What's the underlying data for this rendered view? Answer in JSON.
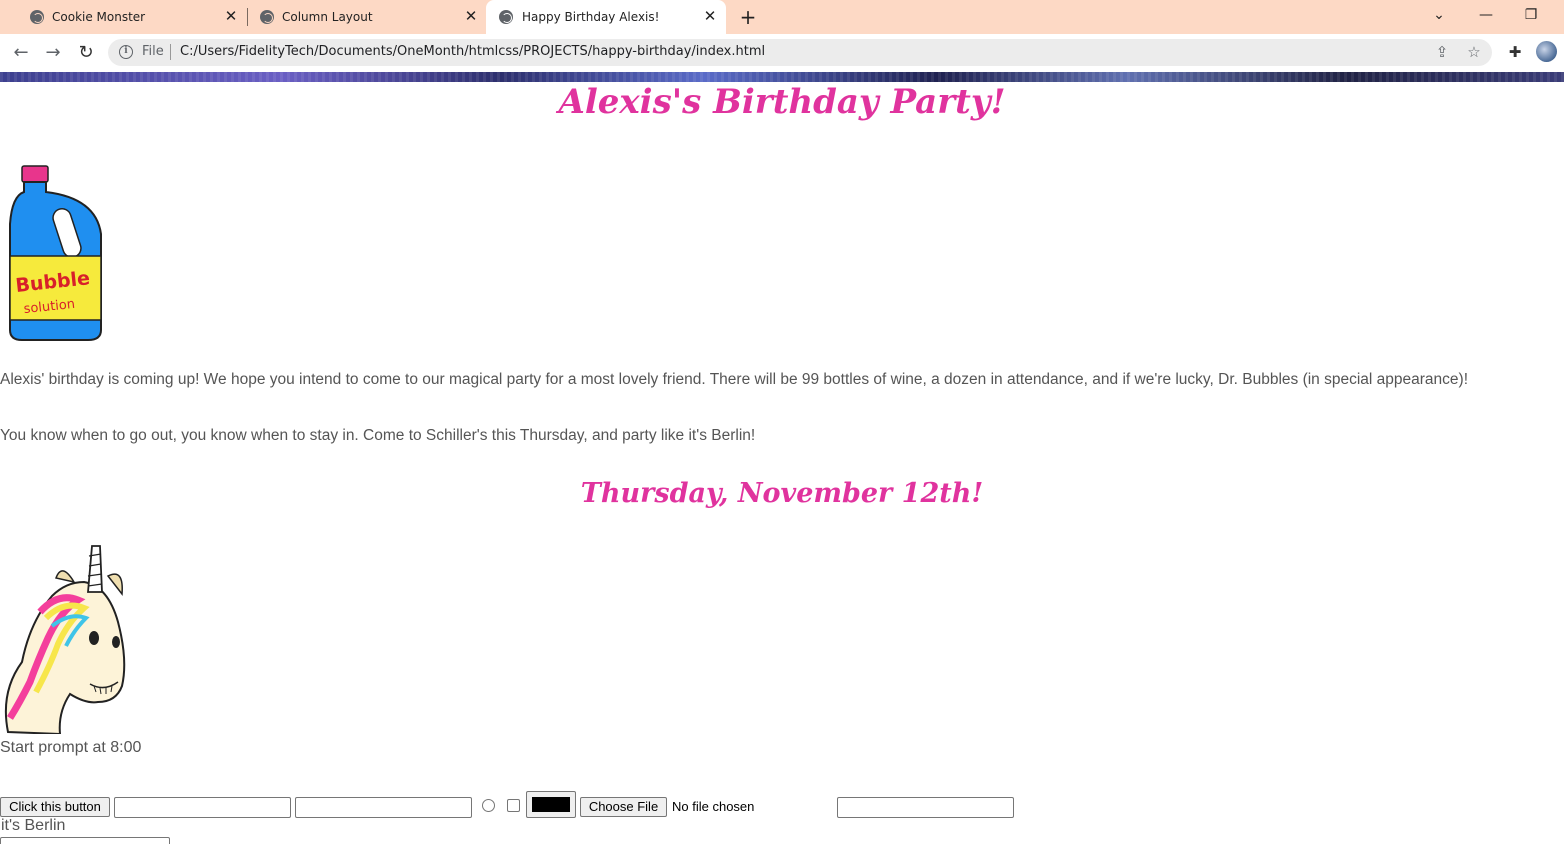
{
  "browser": {
    "tabs": [
      {
        "title": "Cookie Monster",
        "active": false
      },
      {
        "title": "Column Layout",
        "active": false
      },
      {
        "title": "Happy Birthday Alexis!",
        "active": true
      }
    ],
    "address": {
      "scheme_label": "File",
      "url": "C:/Users/FidelityTech/Documents/OneMonth/htmlcss/PROJECTS/happy-birthday/index.html"
    }
  },
  "page": {
    "title": "Alexis's Birthday Party!",
    "intro": "Alexis' birthday is coming up! We hope you intend to come to our magical party for a most lovely friend. There will be 99 bottles of wine, a dozen in attendance, and if we're lucky, Dr. Bubbles (in special appearance)!",
    "tagline": "You know when to go out, you know when to stay in. Come to Schiller's this Thursday, and party like it's Berlin!",
    "date_heading": "Thursday, November 12th!",
    "bubble_label_top": "Bubble",
    "bubble_label_bottom": "solution",
    "start_prompt": "Start prompt at 8:00",
    "form": {
      "button_label": "Click this button",
      "file_button_label": "Choose File",
      "file_status": "No file chosen",
      "color_value": "#000000",
      "trailing_text": "it's Berlin"
    }
  },
  "colors": {
    "accent": "#e0339e",
    "tab_bar": "#fdd9c5",
    "body_text": "#555555"
  }
}
